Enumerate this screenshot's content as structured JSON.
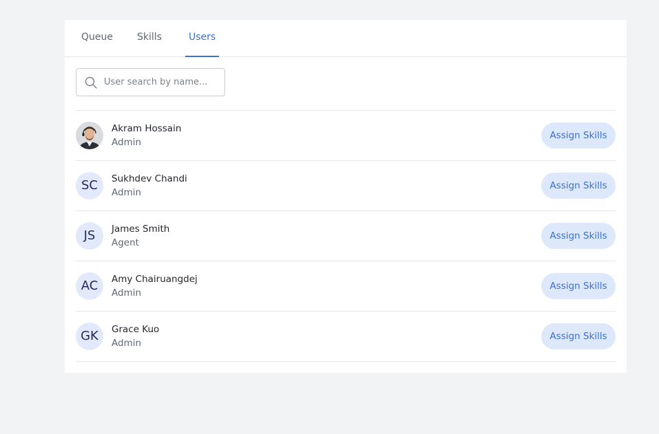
{
  "tabs": [
    {
      "label": "Queue"
    },
    {
      "label": "Skills"
    },
    {
      "label": "Users"
    }
  ],
  "active_tab": "Users",
  "search": {
    "placeholder": "User search by name..."
  },
  "assign_label": "Assign Skills",
  "users": [
    {
      "name": "Akram Hossain",
      "role": "Admin",
      "initials": ""
    },
    {
      "name": "Sukhdev Chandi",
      "role": "Admin",
      "initials": "SC"
    },
    {
      "name": "James Smith",
      "role": "Agent",
      "initials": "JS"
    },
    {
      "name": "Amy Chairuangdej",
      "role": "Admin",
      "initials": "AC"
    },
    {
      "name": "Grace Kuo",
      "role": "Admin",
      "initials": "GK"
    }
  ],
  "colors": {
    "accent": "#3b6fd4",
    "button_bg": "#dde8fb",
    "avatar_bg": "#e2e9fb"
  }
}
